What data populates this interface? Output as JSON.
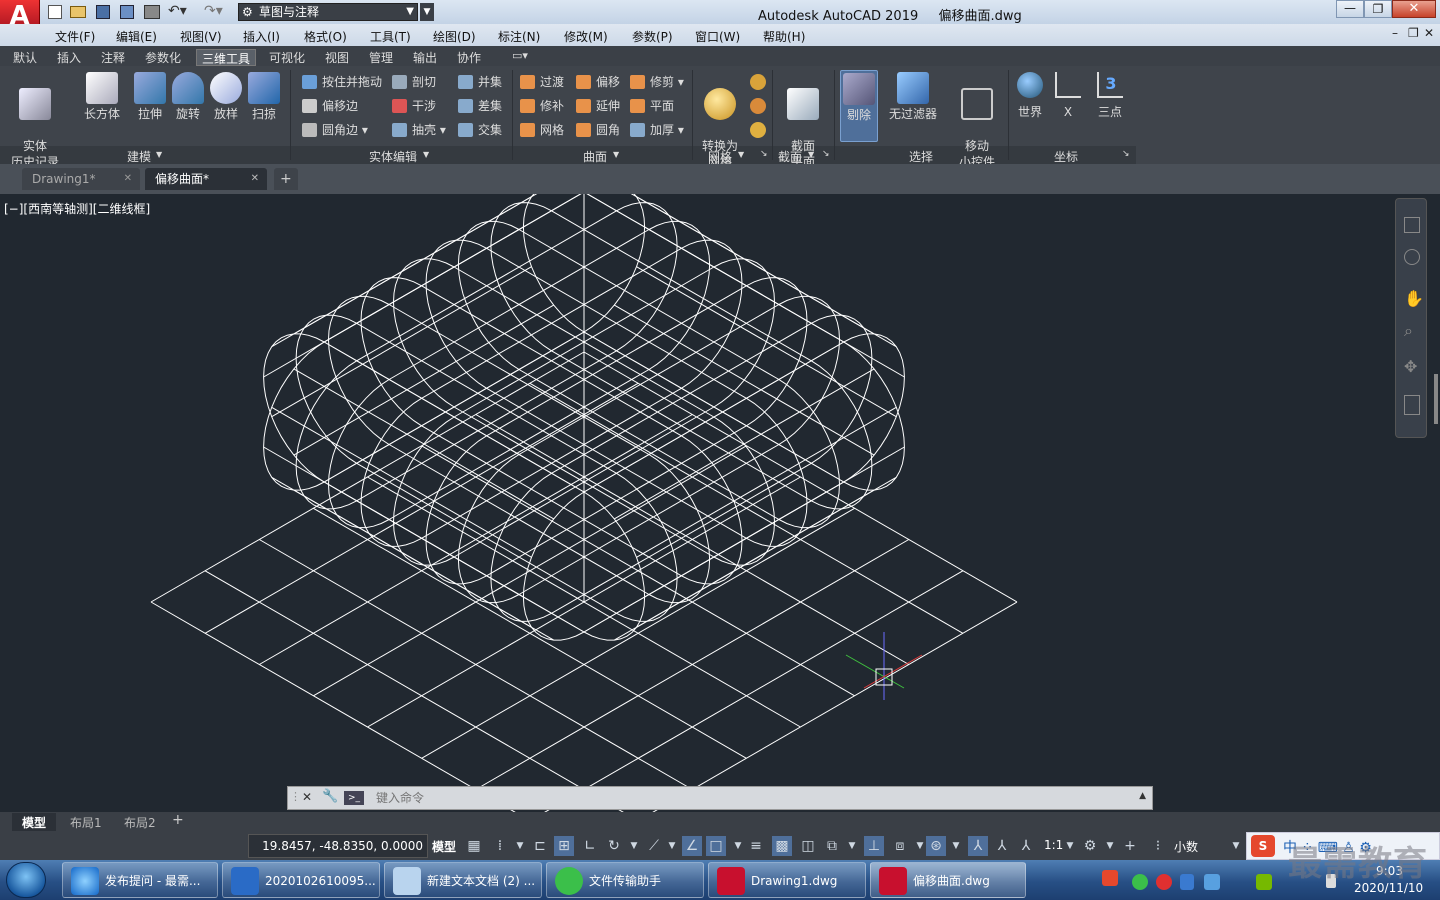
{
  "app": {
    "title": "Autodesk AutoCAD 2019",
    "file": "偏移曲面.dwg",
    "workspace": "草图与注释"
  },
  "menus": [
    "文件(F)",
    "编辑(E)",
    "视图(V)",
    "插入(I)",
    "格式(O)",
    "工具(T)",
    "绘图(D)",
    "标注(N)",
    "修改(M)",
    "参数(P)",
    "窗口(W)",
    "帮助(H)"
  ],
  "ribbon_tabs": [
    "默认",
    "插入",
    "注释",
    "参数化",
    "三维工具",
    "可视化",
    "视图",
    "管理",
    "输出",
    "协作"
  ],
  "ribbon_active_tab": "三维工具",
  "panels": {
    "modeling": {
      "label": "建模",
      "buttons": [
        "实体\n历史记录",
        "长方体",
        "拉伸",
        "旋转",
        "放样",
        "扫掠"
      ]
    },
    "solid_edit": {
      "label": "实体编辑",
      "items": [
        "按住并拖动",
        "剖切",
        "并集",
        "偏移边",
        "干涉",
        "差集",
        "圆角边",
        "抽壳",
        "交集"
      ]
    },
    "surface": {
      "label": "曲面",
      "items": [
        "过渡",
        "偏移",
        "修剪",
        "修补",
        "延伸",
        "平面",
        "网格",
        "圆角",
        "加厚"
      ]
    },
    "mesh": {
      "label": "网格",
      "button": "转换为\n网格"
    },
    "section": {
      "label": "截面",
      "button": "截面\n平面"
    },
    "selection": {
      "label": "选择",
      "buttons": [
        "剔除",
        "无过滤器",
        "移动\n小控件"
      ]
    },
    "coords": {
      "label": "坐标",
      "buttons": [
        "世界",
        "X",
        "三点"
      ]
    }
  },
  "file_tabs": [
    "Drawing1*",
    "偏移曲面*"
  ],
  "active_file_tab": "偏移曲面*",
  "viewport_label": "[−][西南等轴测][二维线框]",
  "command_placeholder": "键入命令",
  "layout_tabs": [
    "模型",
    "布局1",
    "布局2"
  ],
  "status": {
    "coords": "19.8457, -48.8350, 0.0000",
    "space": "模型",
    "scale": "1:1",
    "units": "小数"
  },
  "taskbar": {
    "items": [
      "发布提问 - 最需...",
      "2020102610095...",
      "新建文本文档 (2) ...",
      "文件传输助手",
      "Drawing1.dwg",
      "偏移曲面.dwg"
    ],
    "time": "9:03",
    "date": "2020/11/10",
    "watermark": "最需教育"
  },
  "colors": {
    "accent": "#c8102e",
    "viewport_bg": "#212830",
    "wire": "#ffffff",
    "ribbon_bg": "#3f444b"
  }
}
